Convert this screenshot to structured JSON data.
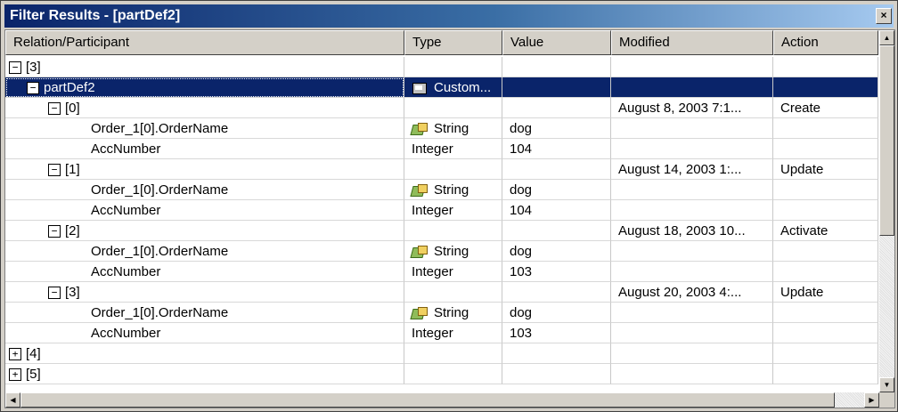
{
  "window": {
    "title": "Filter Results - [partDef2]",
    "close_label": "×"
  },
  "columns": [
    "Relation/Participant",
    "Type",
    "Value",
    "Modified",
    "Action"
  ],
  "rows": [
    {
      "indent": 0,
      "toggle": "−",
      "name": "[3]",
      "type": "",
      "type_icon": "",
      "value": "",
      "modified": "",
      "action": ""
    },
    {
      "indent": 1,
      "toggle": "−",
      "name": "partDef2",
      "type": "Custom...",
      "type_icon": "custom-type-icon",
      "value": "",
      "modified": "",
      "action": "",
      "selected": true
    },
    {
      "indent": 2,
      "toggle": "−",
      "name": "[0]",
      "type": "",
      "type_icon": "",
      "value": "",
      "modified": "August 8, 2003 7:1...",
      "action": "Create"
    },
    {
      "indent": 3,
      "toggle": "",
      "name": "Order_1[0].OrderName",
      "type": "String",
      "type_icon": "string-type-icon",
      "value": "dog",
      "modified": "",
      "action": ""
    },
    {
      "indent": 3,
      "toggle": "",
      "name": "AccNumber",
      "type": "Integer",
      "type_icon": "",
      "value": "104",
      "modified": "",
      "action": ""
    },
    {
      "indent": 2,
      "toggle": "−",
      "name": "[1]",
      "type": "",
      "type_icon": "",
      "value": "",
      "modified": "August 14, 2003 1:...",
      "action": "Update"
    },
    {
      "indent": 3,
      "toggle": "",
      "name": "Order_1[0].OrderName",
      "type": "String",
      "type_icon": "string-type-icon",
      "value": "dog",
      "modified": "",
      "action": ""
    },
    {
      "indent": 3,
      "toggle": "",
      "name": "AccNumber",
      "type": "Integer",
      "type_icon": "",
      "value": "104",
      "modified": "",
      "action": ""
    },
    {
      "indent": 2,
      "toggle": "−",
      "name": "[2]",
      "type": "",
      "type_icon": "",
      "value": "",
      "modified": "August 18, 2003 10...",
      "action": "Activate"
    },
    {
      "indent": 3,
      "toggle": "",
      "name": "Order_1[0].OrderName",
      "type": "String",
      "type_icon": "string-type-icon",
      "value": "dog",
      "modified": "",
      "action": ""
    },
    {
      "indent": 3,
      "toggle": "",
      "name": "AccNumber",
      "type": "Integer",
      "type_icon": "",
      "value": "103",
      "modified": "",
      "action": ""
    },
    {
      "indent": 2,
      "toggle": "−",
      "name": "[3]",
      "type": "",
      "type_icon": "",
      "value": "",
      "modified": "August 20, 2003 4:...",
      "action": "Update"
    },
    {
      "indent": 3,
      "toggle": "",
      "name": "Order_1[0].OrderName",
      "type": "String",
      "type_icon": "string-type-icon",
      "value": "dog",
      "modified": "",
      "action": ""
    },
    {
      "indent": 3,
      "toggle": "",
      "name": "AccNumber",
      "type": "Integer",
      "type_icon": "",
      "value": "103",
      "modified": "",
      "action": ""
    },
    {
      "indent": 0,
      "toggle": "+",
      "name": "[4]",
      "type": "",
      "type_icon": "",
      "value": "",
      "modified": "",
      "action": ""
    },
    {
      "indent": 0,
      "toggle": "+",
      "name": "[5]",
      "type": "",
      "type_icon": "",
      "value": "",
      "modified": "",
      "action": ""
    }
  ],
  "scrollbars": {
    "vertical": {
      "up_icon": "scroll-up-arrow-icon",
      "down_icon": "scroll-down-arrow-icon",
      "up_glyph": "▲",
      "down_glyph": "▼"
    },
    "horizontal": {
      "left_icon": "scroll-left-arrow-icon",
      "right_icon": "scroll-right-arrow-icon",
      "left_glyph": "◀",
      "right_glyph": "▶"
    }
  },
  "colors": {
    "titlebar": "#0a246a",
    "selection": "#0a246a",
    "chrome": "#d4d0c8"
  }
}
